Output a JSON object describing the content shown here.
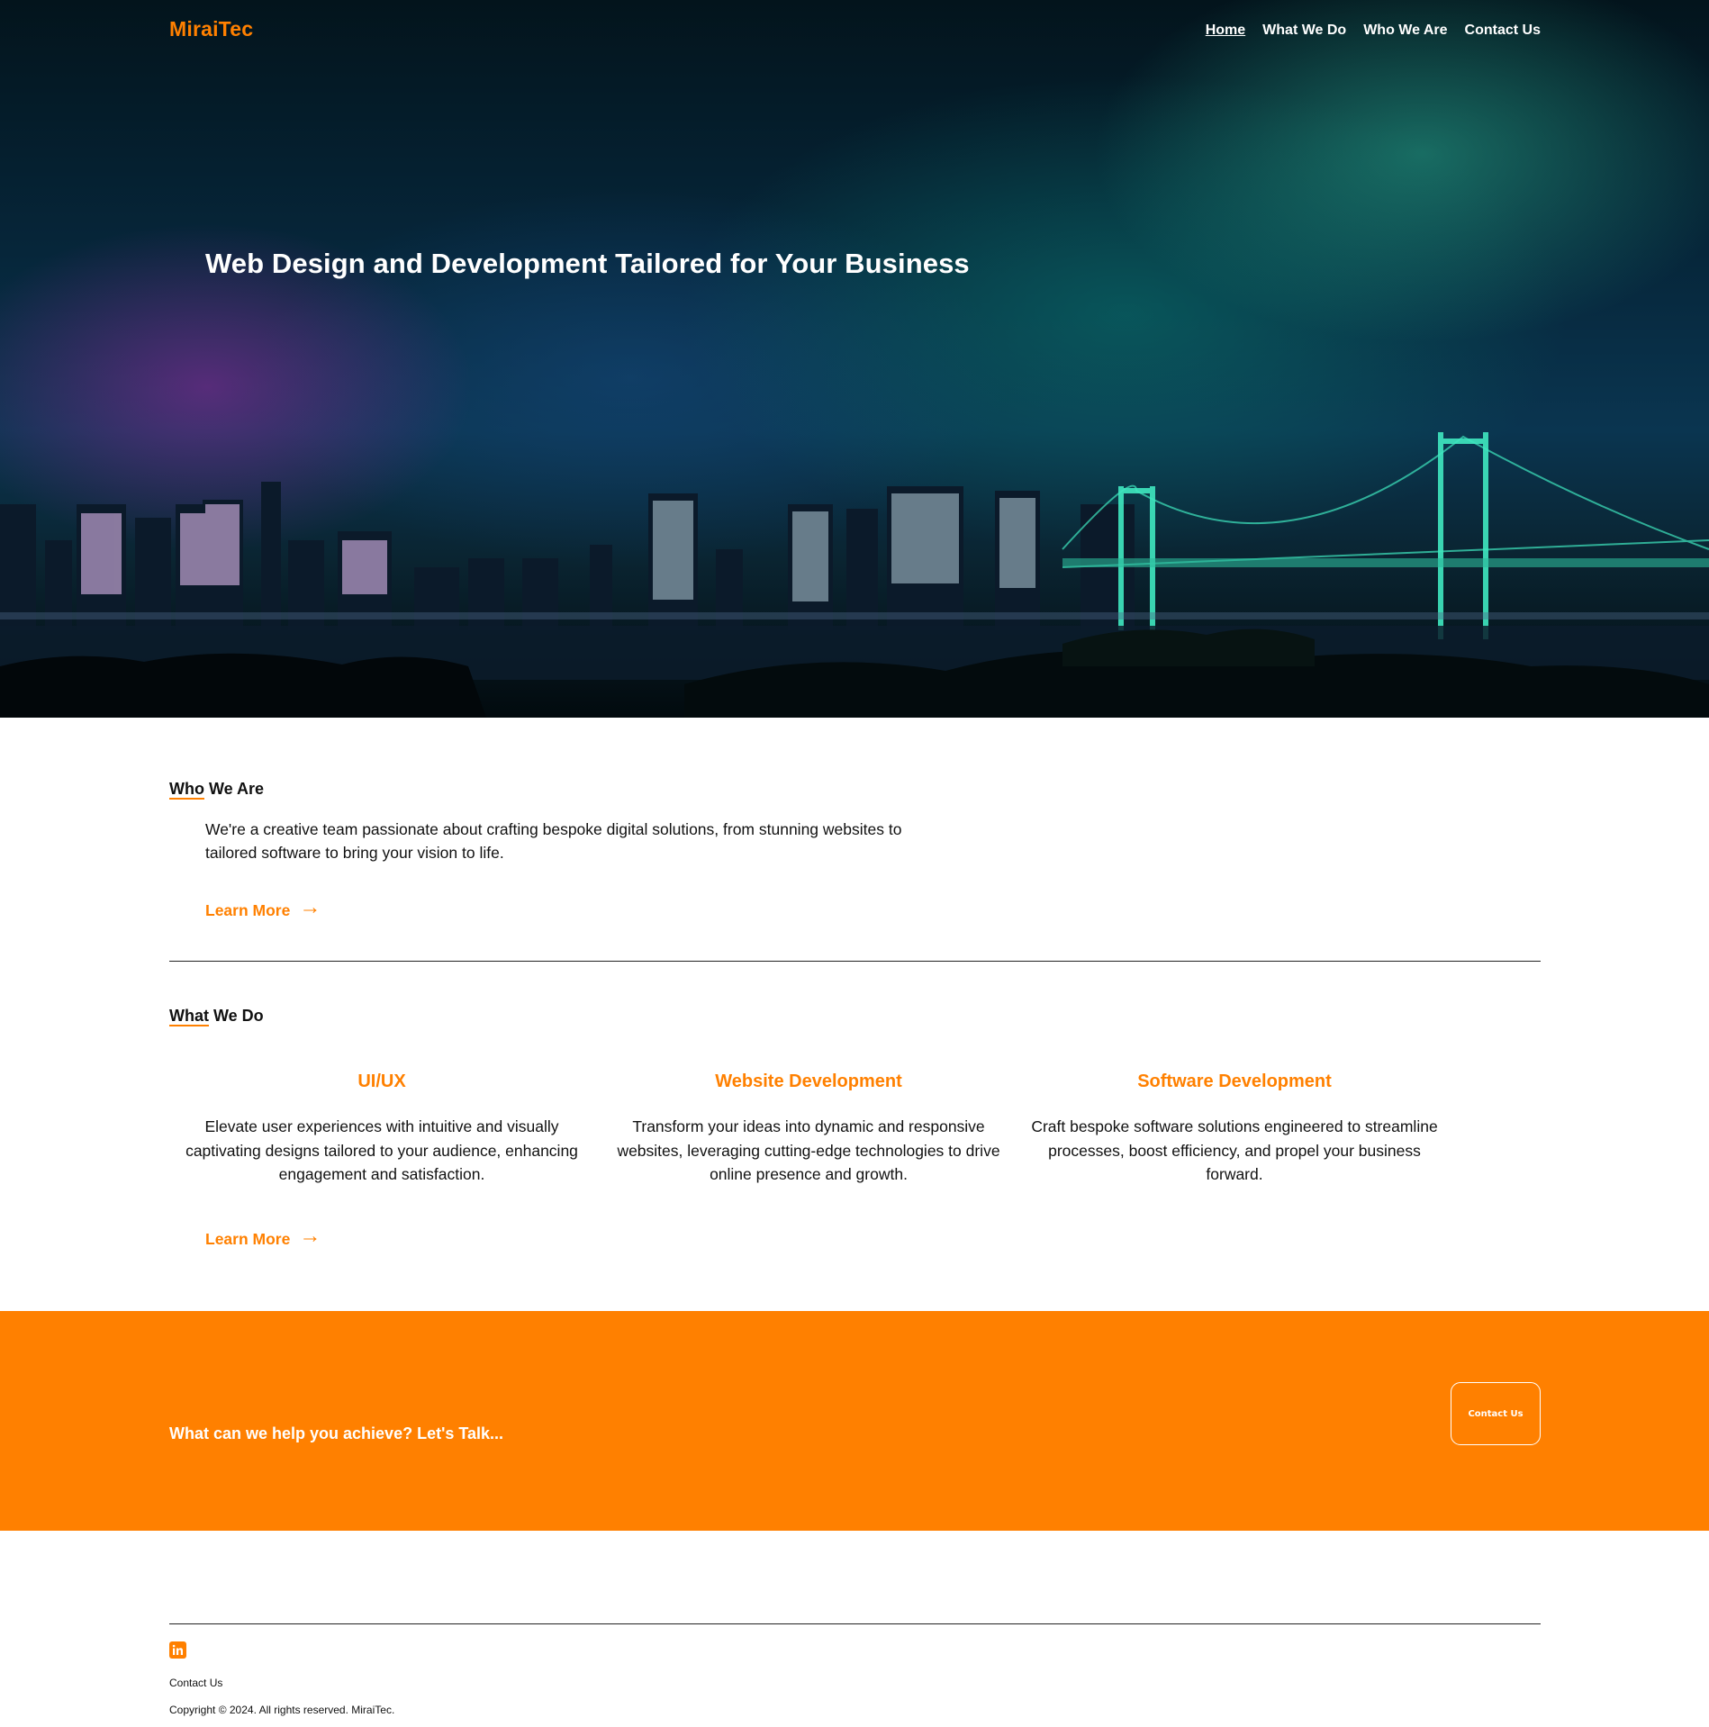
{
  "header": {
    "logo": "MiraiTec",
    "nav": [
      {
        "label": "Home",
        "active": true
      },
      {
        "label": "What We Do",
        "active": false
      },
      {
        "label": "Who We Are",
        "active": false
      },
      {
        "label": "Contact Us",
        "active": false
      }
    ]
  },
  "hero": {
    "title": "Web Design and Development Tailored for Your Business"
  },
  "who": {
    "heading_underlined": "Who",
    "heading_rest": " We Are",
    "text": "We're a creative team passionate about crafting bespoke digital solutions, from stunning websites to tailored software to bring your vision to life.",
    "learn_more": "Learn More",
    "arrow": "→"
  },
  "what": {
    "heading_underlined": "What",
    "heading_rest": " We Do",
    "services": [
      {
        "title": "UI/UX",
        "text": "Elevate user experiences with intuitive and visually captivating designs tailored to your audience, enhancing engagement and satisfaction."
      },
      {
        "title": "Website Development",
        "text": "Transform your ideas into dynamic and responsive websites, leveraging cutting-edge technologies to drive online presence and growth."
      },
      {
        "title": "Software Development",
        "text": "Craft bespoke software solutions engineered to streamline processes, boost efficiency, and propel your business forward."
      }
    ],
    "learn_more": "Learn More",
    "arrow": "→"
  },
  "cta": {
    "text": "What can we help you achieve? Let's Talk...",
    "button": "Contact Us"
  },
  "footer": {
    "social_icon": "linkedin-icon",
    "contact": "Contact Us",
    "copyright": "Copyright © 2024. All rights reserved. MiraiTec."
  },
  "colors": {
    "accent": "#ff8000",
    "text": "#111111",
    "background": "#ffffff"
  }
}
